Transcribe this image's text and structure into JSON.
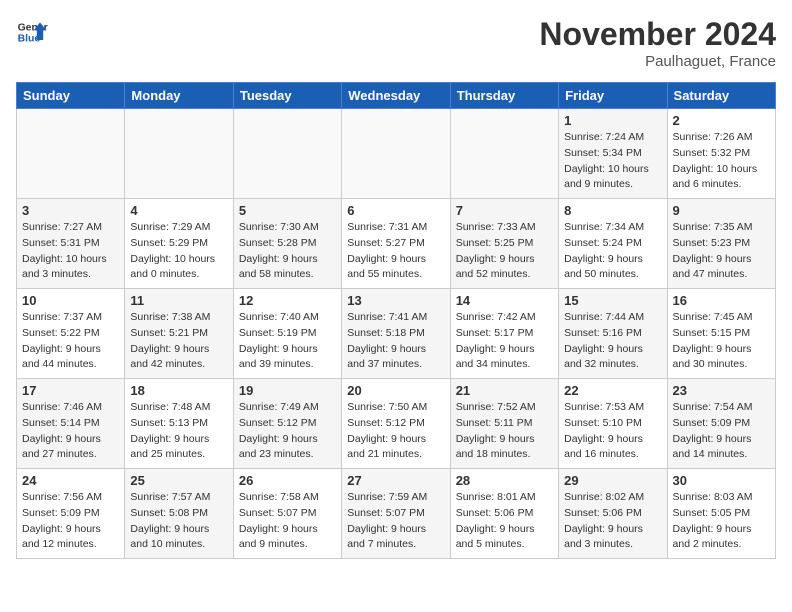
{
  "header": {
    "logo_line1": "General",
    "logo_line2": "Blue",
    "month": "November 2024",
    "location": "Paulhaguet, France"
  },
  "weekdays": [
    "Sunday",
    "Monday",
    "Tuesday",
    "Wednesday",
    "Thursday",
    "Friday",
    "Saturday"
  ],
  "weeks": [
    [
      {
        "day": "",
        "info": "",
        "empty": true
      },
      {
        "day": "",
        "info": "",
        "empty": true
      },
      {
        "day": "",
        "info": "",
        "empty": true
      },
      {
        "day": "",
        "info": "",
        "empty": true
      },
      {
        "day": "",
        "info": "",
        "empty": true
      },
      {
        "day": "1",
        "info": "Sunrise: 7:24 AM\nSunset: 5:34 PM\nDaylight: 10 hours and 9 minutes.",
        "shaded": true
      },
      {
        "day": "2",
        "info": "Sunrise: 7:26 AM\nSunset: 5:32 PM\nDaylight: 10 hours and 6 minutes.",
        "shaded": false
      }
    ],
    [
      {
        "day": "3",
        "info": "Sunrise: 7:27 AM\nSunset: 5:31 PM\nDaylight: 10 hours and 3 minutes.",
        "shaded": true
      },
      {
        "day": "4",
        "info": "Sunrise: 7:29 AM\nSunset: 5:29 PM\nDaylight: 10 hours and 0 minutes.",
        "shaded": false
      },
      {
        "day": "5",
        "info": "Sunrise: 7:30 AM\nSunset: 5:28 PM\nDaylight: 9 hours and 58 minutes.",
        "shaded": true
      },
      {
        "day": "6",
        "info": "Sunrise: 7:31 AM\nSunset: 5:27 PM\nDaylight: 9 hours and 55 minutes.",
        "shaded": false
      },
      {
        "day": "7",
        "info": "Sunrise: 7:33 AM\nSunset: 5:25 PM\nDaylight: 9 hours and 52 minutes.",
        "shaded": true
      },
      {
        "day": "8",
        "info": "Sunrise: 7:34 AM\nSunset: 5:24 PM\nDaylight: 9 hours and 50 minutes.",
        "shaded": false
      },
      {
        "day": "9",
        "info": "Sunrise: 7:35 AM\nSunset: 5:23 PM\nDaylight: 9 hours and 47 minutes.",
        "shaded": true
      }
    ],
    [
      {
        "day": "10",
        "info": "Sunrise: 7:37 AM\nSunset: 5:22 PM\nDaylight: 9 hours and 44 minutes.",
        "shaded": false
      },
      {
        "day": "11",
        "info": "Sunrise: 7:38 AM\nSunset: 5:21 PM\nDaylight: 9 hours and 42 minutes.",
        "shaded": true
      },
      {
        "day": "12",
        "info": "Sunrise: 7:40 AM\nSunset: 5:19 PM\nDaylight: 9 hours and 39 minutes.",
        "shaded": false
      },
      {
        "day": "13",
        "info": "Sunrise: 7:41 AM\nSunset: 5:18 PM\nDaylight: 9 hours and 37 minutes.",
        "shaded": true
      },
      {
        "day": "14",
        "info": "Sunrise: 7:42 AM\nSunset: 5:17 PM\nDaylight: 9 hours and 34 minutes.",
        "shaded": false
      },
      {
        "day": "15",
        "info": "Sunrise: 7:44 AM\nSunset: 5:16 PM\nDaylight: 9 hours and 32 minutes.",
        "shaded": true
      },
      {
        "day": "16",
        "info": "Sunrise: 7:45 AM\nSunset: 5:15 PM\nDaylight: 9 hours and 30 minutes.",
        "shaded": false
      }
    ],
    [
      {
        "day": "17",
        "info": "Sunrise: 7:46 AM\nSunset: 5:14 PM\nDaylight: 9 hours and 27 minutes.",
        "shaded": true
      },
      {
        "day": "18",
        "info": "Sunrise: 7:48 AM\nSunset: 5:13 PM\nDaylight: 9 hours and 25 minutes.",
        "shaded": false
      },
      {
        "day": "19",
        "info": "Sunrise: 7:49 AM\nSunset: 5:12 PM\nDaylight: 9 hours and 23 minutes.",
        "shaded": true
      },
      {
        "day": "20",
        "info": "Sunrise: 7:50 AM\nSunset: 5:12 PM\nDaylight: 9 hours and 21 minutes.",
        "shaded": false
      },
      {
        "day": "21",
        "info": "Sunrise: 7:52 AM\nSunset: 5:11 PM\nDaylight: 9 hours and 18 minutes.",
        "shaded": true
      },
      {
        "day": "22",
        "info": "Sunrise: 7:53 AM\nSunset: 5:10 PM\nDaylight: 9 hours and 16 minutes.",
        "shaded": false
      },
      {
        "day": "23",
        "info": "Sunrise: 7:54 AM\nSunset: 5:09 PM\nDaylight: 9 hours and 14 minutes.",
        "shaded": true
      }
    ],
    [
      {
        "day": "24",
        "info": "Sunrise: 7:56 AM\nSunset: 5:09 PM\nDaylight: 9 hours and 12 minutes.",
        "shaded": false
      },
      {
        "day": "25",
        "info": "Sunrise: 7:57 AM\nSunset: 5:08 PM\nDaylight: 9 hours and 10 minutes.",
        "shaded": true
      },
      {
        "day": "26",
        "info": "Sunrise: 7:58 AM\nSunset: 5:07 PM\nDaylight: 9 hours and 9 minutes.",
        "shaded": false
      },
      {
        "day": "27",
        "info": "Sunrise: 7:59 AM\nSunset: 5:07 PM\nDaylight: 9 hours and 7 minutes.",
        "shaded": true
      },
      {
        "day": "28",
        "info": "Sunrise: 8:01 AM\nSunset: 5:06 PM\nDaylight: 9 hours and 5 minutes.",
        "shaded": false
      },
      {
        "day": "29",
        "info": "Sunrise: 8:02 AM\nSunset: 5:06 PM\nDaylight: 9 hours and 3 minutes.",
        "shaded": true
      },
      {
        "day": "30",
        "info": "Sunrise: 8:03 AM\nSunset: 5:05 PM\nDaylight: 9 hours and 2 minutes.",
        "shaded": false
      }
    ]
  ]
}
